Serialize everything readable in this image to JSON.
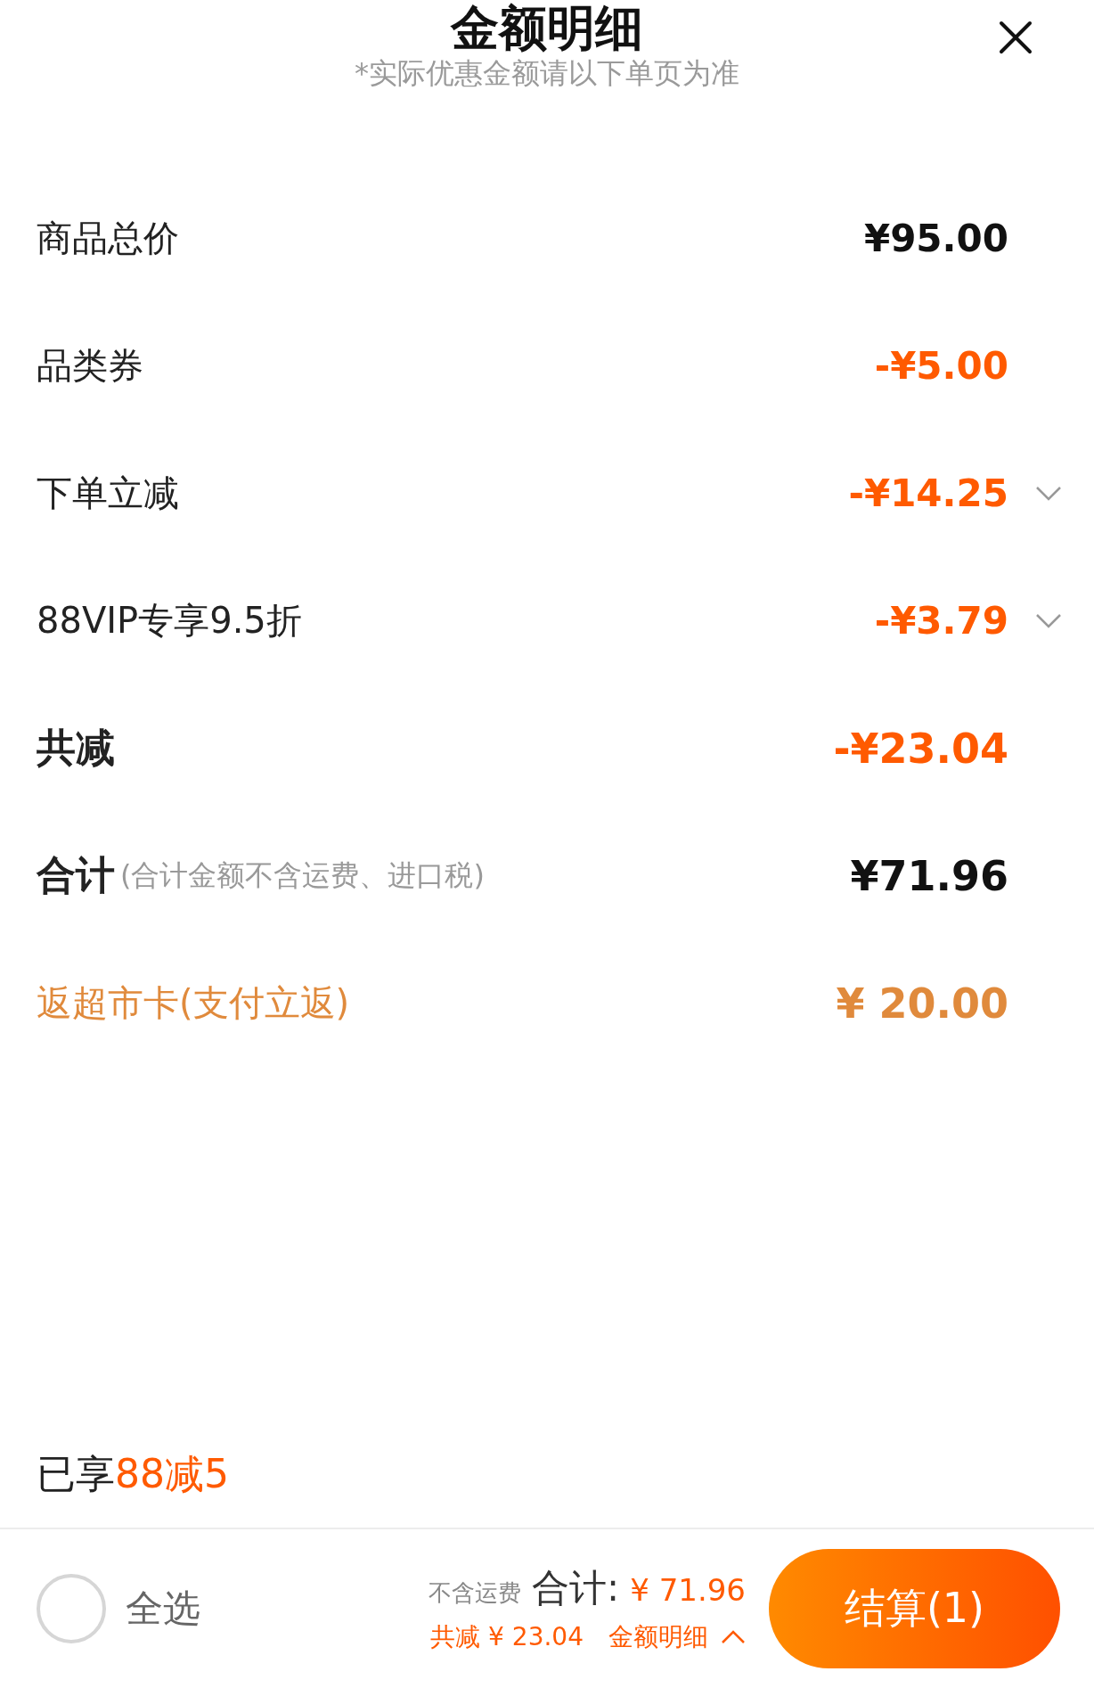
{
  "header": {
    "title": "金额明细",
    "subtitle": "*实际优惠金额请以下单页为准"
  },
  "rows": [
    {
      "kind": "price",
      "label": "商品总价",
      "amount": "¥95.00",
      "expandable": false
    },
    {
      "kind": "discount",
      "label": "品类券",
      "amount": "-¥5.00",
      "expandable": false
    },
    {
      "kind": "discount",
      "label": "下单立减",
      "amount": "-¥14.25",
      "expandable": true
    },
    {
      "kind": "discount",
      "label": "88VIP专享9.5折",
      "amount": "-¥3.79",
      "expandable": true
    },
    {
      "kind": "sum",
      "label": "共减",
      "amount": "-¥23.04",
      "expandable": false
    },
    {
      "kind": "total",
      "label": "合计",
      "note": "(合计金额不含运费、进口税)",
      "amount": "¥71.96",
      "expandable": false
    },
    {
      "kind": "rebate",
      "label": "返超市卡(支付立返)",
      "amount": "¥ 20.00",
      "expandable": false
    }
  ],
  "promo": {
    "prefix": "已享",
    "highlight": "88减5"
  },
  "bottom_bar": {
    "select_all": {
      "label": "全选",
      "checked": false
    },
    "shipping_note": "不含运费",
    "total_label": "合计:",
    "total_amount": "¥ 71.96",
    "saving": "共减 ¥ 23.04",
    "details_link": "金额明细",
    "checkout_button": "结算(1)"
  }
}
